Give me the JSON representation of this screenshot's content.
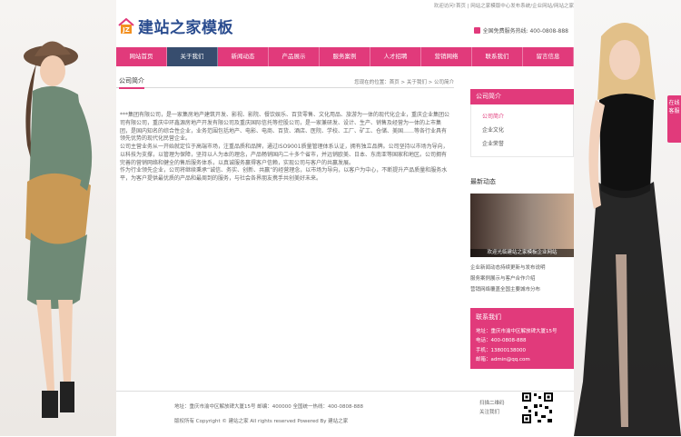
{
  "topbar": {
    "text": "欢迎访问!首页 | 网站之家模版中心发布系统/企业网站/网站之家"
  },
  "logo": {
    "badge": "JZ",
    "text": "建站之家模板"
  },
  "hotline": {
    "text": "全国免费服务热线: 400-0808-888"
  },
  "nav": [
    "网站首页",
    "关于我们",
    "新闻动态",
    "产品展示",
    "服务案例",
    "人才招聘",
    "营销网络",
    "联系我们",
    "留言信息"
  ],
  "page": {
    "title": "公司简介",
    "crumb": "您现在的位置：首页 > 关于我们 > 公司简介",
    "paragraphs": [
      "***集团有限公司，是一家集房地产建筑开发、影视、影院、餐饮娱乐、百货零售、文化用品、旅游为一体的现代化企业，重庆企业集团公司有限公司，重庆中环鑫源房地产开发有限公司及重庆国际信托等控股公司，是一家兼研发、设计、生产、销售及经营为一体的上市集团，是国内知名的综合性企业，业务范围包括地产、电影、电商、百货、酒店、医院、学校、工厂、矿工、仓储、美国……等各行业具有领先优势的现代化民营企业。",
      "公司主营业务从一开始就定位于高端市场，注重品质和品牌，通过ISO9001质量管理体系认证，拥有独立品牌。公司坚持以市场为导向，以科技为支撑，以管理为保障，坚持以人为本的理念，产品畅销国内二十多个省市，并远销欧美、日本、东南亚等国家和地区。公司拥有完善的营销网络和健全的售后服务体系，以真诚服务赢得客户信赖，实现公司与客户的共赢发展。",
      "作为行业领先企业，公司将继续秉承“诚信、务实、创新、共赢”的经营理念，以市场为导向，以客户为中心，不断提升产品质量和服务水平，为客户提供最优质的产品和最周到的服务，与社会各界朋友携手共创美好未来。"
    ]
  },
  "sidebar": {
    "head": "公司简介",
    "items": [
      "公司简介",
      "企业文化",
      "企业荣誉"
    ],
    "rec_title": "最新动态",
    "rec_caption": "欢迎光临建站之家模板企业网站",
    "rec_list": [
      "企业新闻动态持续更新与发布说明",
      "服务案例展示与客户合作介绍",
      "营销网络覆盖全国主要城市分布"
    ]
  },
  "contact": {
    "head": "联系我们",
    "lines": [
      "地址：重庆市渝中区解放碑大厦15号",
      "电话：400-0808-888",
      "手机：13800138000",
      "邮箱：admin@qq.com"
    ]
  },
  "footer": {
    "l1": "地址：重庆市渝中区解放碑大厦15号 邮编：400000 全国统一热线：400-0808-888",
    "l2": "版权所有 Copyright © 建站之家 All rights reserved Powered By 建站之家",
    "qrtxt1": "扫描二维码",
    "qrtxt2": "关注我们"
  },
  "kefu": {
    "text": "在线客服"
  },
  "colors": {
    "accent": "#e13a7b",
    "nav_active": "#374d6e",
    "logo": "#2a4c8f"
  }
}
